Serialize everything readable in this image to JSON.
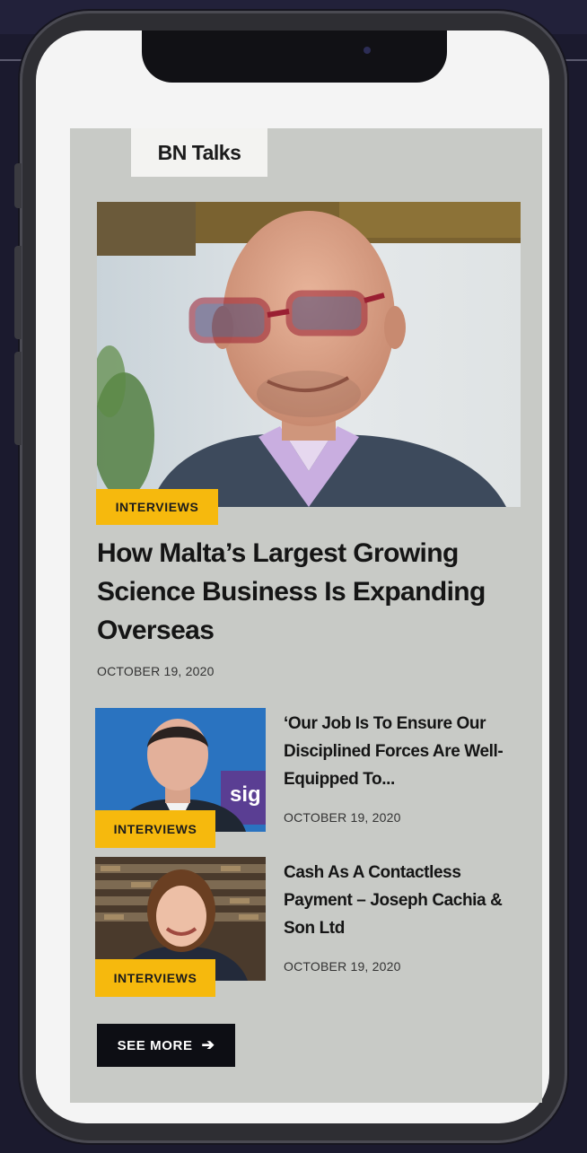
{
  "brand": {
    "name": "BN Talks"
  },
  "featured": {
    "category": "INTERVIEWS",
    "title": "How Malta’s Largest Growing Science Business Is Expanding Overseas",
    "date": "OCTOBER 19, 2020"
  },
  "articles": [
    {
      "category": "INTERVIEWS",
      "title": "‘Our Job Is To Ensure Our Disciplined Forces Are Well-Equipped To...",
      "date": "OCTOBER 19, 2020"
    },
    {
      "category": "INTERVIEWS",
      "title": "Cash As A Contactless Payment – Joseph Cachia & Son Ltd",
      "date": "OCTOBER 19, 2020"
    }
  ],
  "see_more": {
    "label": "SEE MORE",
    "icon": "arrow-right-icon"
  },
  "colors": {
    "accent": "#f6b90d",
    "card": "#c8cac6",
    "button": "#0d0e14",
    "background": "#1b1a2e"
  }
}
